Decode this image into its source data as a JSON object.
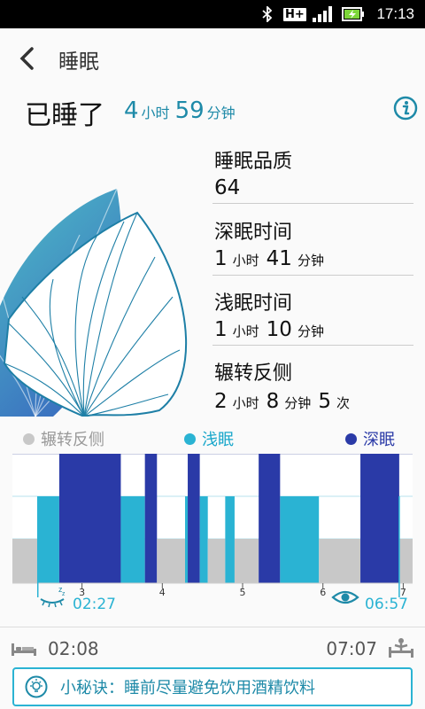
{
  "status_bar": {
    "time": "17:13",
    "network": "H+"
  },
  "header": {
    "title": "睡眠"
  },
  "summary": {
    "label": "已睡了",
    "hours": "4",
    "hours_unit": "小时",
    "minutes": "59",
    "minutes_unit": "分钟"
  },
  "metrics": {
    "quality": {
      "label": "睡眠品质",
      "value": "64"
    },
    "deep": {
      "label": "深眠时间",
      "hours": "1",
      "hours_unit": "小时",
      "minutes": "41",
      "minutes_unit": "分钟"
    },
    "light": {
      "label": "浅眠时间",
      "hours": "1",
      "hours_unit": "小时",
      "minutes": "10",
      "minutes_unit": "分钟"
    },
    "toss": {
      "label": "辗转反侧",
      "hours": "2",
      "hours_unit": "小时",
      "minutes": "8",
      "minutes_unit": "分钟",
      "count": "5",
      "count_unit": "次"
    }
  },
  "legend": {
    "toss": "辗转反侧",
    "light": "浅眠",
    "deep": "深眠"
  },
  "colors": {
    "toss": "#c8c8c8",
    "light": "#2ab3d3",
    "deep": "#2a3aa7",
    "accent": "#1e8aa8"
  },
  "chart_data": {
    "type": "timeline",
    "x_ticks": [
      "3",
      "4",
      "5",
      "6",
      "7"
    ],
    "fall_asleep": "02:27",
    "wake_up": "06:57",
    "stages": [
      {
        "stage": "toss",
        "start": "02:08",
        "end": "02:27"
      },
      {
        "stage": "light",
        "start": "02:27",
        "end": "02:43"
      },
      {
        "stage": "deep",
        "start": "02:43",
        "end": "03:29"
      },
      {
        "stage": "light",
        "start": "03:29",
        "end": "03:47"
      },
      {
        "stage": "deep",
        "start": "03:47",
        "end": "03:56"
      },
      {
        "stage": "toss",
        "start": "03:56",
        "end": "04:17"
      },
      {
        "stage": "light",
        "start": "04:17",
        "end": "04:19"
      },
      {
        "stage": "deep",
        "start": "04:19",
        "end": "04:28"
      },
      {
        "stage": "light",
        "start": "04:28",
        "end": "04:34"
      },
      {
        "stage": "toss",
        "start": "04:34",
        "end": "04:47"
      },
      {
        "stage": "light",
        "start": "04:47",
        "end": "04:54"
      },
      {
        "stage": "toss",
        "start": "04:54",
        "end": "05:12"
      },
      {
        "stage": "deep",
        "start": "05:12",
        "end": "05:28"
      },
      {
        "stage": "light",
        "start": "05:28",
        "end": "05:57"
      },
      {
        "stage": "toss",
        "start": "05:57",
        "end": "06:28"
      },
      {
        "stage": "deep",
        "start": "06:28",
        "end": "06:57"
      },
      {
        "stage": "toss",
        "start": "06:57",
        "end": "07:07"
      }
    ]
  },
  "bed_time": "02:08",
  "rise_time": "07:07",
  "tip": "小秘诀：睡前尽量避免饮用酒精饮料"
}
